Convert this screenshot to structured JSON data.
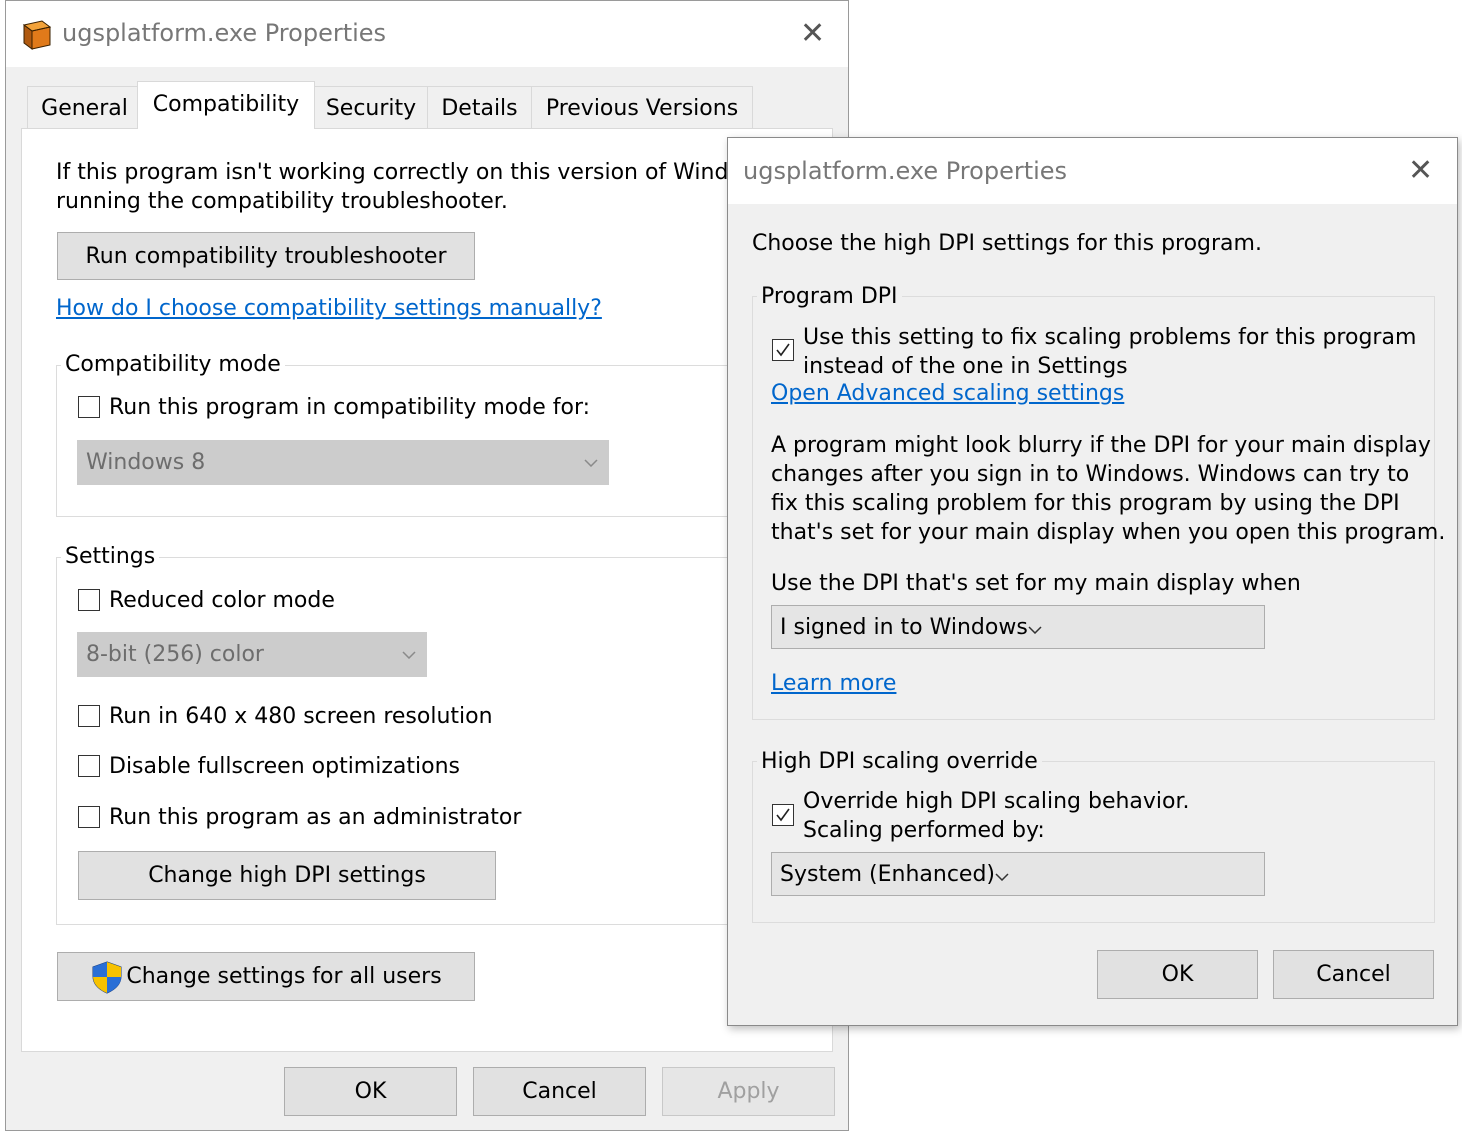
{
  "main_dialog": {
    "title": "ugsplatform.exe Properties",
    "close_glyph": "✕",
    "tabs": [
      {
        "label": "General",
        "active": false
      },
      {
        "label": "Compatibility",
        "active": true
      },
      {
        "label": "Security",
        "active": false
      },
      {
        "label": "Details",
        "active": false
      },
      {
        "label": "Previous Versions",
        "active": false
      }
    ],
    "intro_line1": "If this program isn't working correctly on this version of Windows, try",
    "intro_line2": "running the compatibility troubleshooter.",
    "troubleshooter_button": "Run compatibility troubleshooter",
    "manual_link": "How do I choose compatibility settings manually?",
    "compat_mode": {
      "group_label": "Compatibility mode",
      "checkbox_label": "Run this program in compatibility mode for:",
      "checked": false,
      "os_select_value": "Windows 8"
    },
    "settings": {
      "group_label": "Settings",
      "reduced_color_label": "Reduced color mode",
      "reduced_color_checked": false,
      "color_select_value": "8-bit (256) color",
      "resolution_label": "Run in 640 x 480 screen resolution",
      "resolution_checked": false,
      "fullscreen_label": "Disable fullscreen optimizations",
      "fullscreen_checked": false,
      "admin_label": "Run this program as an administrator",
      "admin_checked": false,
      "dpi_button": "Change high DPI settings"
    },
    "all_users_button": "Change settings for all users",
    "ok_button": "OK",
    "cancel_button": "Cancel",
    "apply_button": "Apply",
    "icons": {
      "app": "app-box-icon",
      "shield": "uac-shield-icon"
    },
    "colors": {
      "link": "#0066cc",
      "button_bg": "#e1e1e1",
      "dialog_bg": "#f0f0f0"
    }
  },
  "dpi_dialog": {
    "title": "ugsplatform.exe Properties",
    "close_glyph": "✕",
    "heading": "Choose the high DPI settings for this program.",
    "program_dpi": {
      "group_label": "Program DPI",
      "checkbox_line1": "Use this setting to fix scaling problems for this program",
      "checkbox_line2": "instead of the one in Settings",
      "checked": true,
      "advanced_link": "Open Advanced scaling settings",
      "para_line1": "A program might look blurry if the DPI for your main display",
      "para_line2": "changes after you sign in to Windows. Windows can try to",
      "para_line3": "fix this scaling problem for this program by using the DPI",
      "para_line4": "that's set for your main display when you open this program.",
      "use_dpi_label": "Use the DPI that's set for my main display when",
      "dpi_select_value": "I signed in to Windows",
      "learn_more_link": "Learn more"
    },
    "override": {
      "group_label": "High DPI scaling override",
      "checkbox_line1": "Override high DPI scaling behavior.",
      "checkbox_line2": "Scaling performed by:",
      "checked": true,
      "scaling_select_value": "System (Enhanced)"
    },
    "ok_button": "OK",
    "cancel_button": "Cancel"
  }
}
